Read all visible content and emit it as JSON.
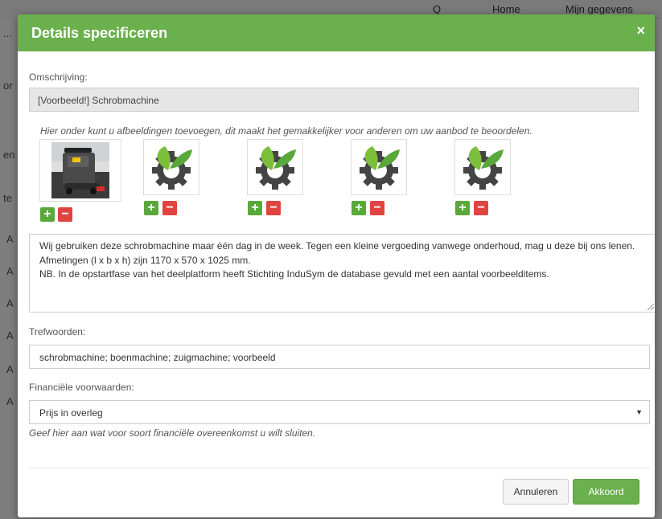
{
  "background": {
    "nav": {
      "search": "Q",
      "home": "Home",
      "account": "Mijn gegevens"
    },
    "left_fragments": [
      "...",
      "or",
      "en",
      "te",
      "A",
      "A",
      "A",
      "A",
      "A",
      "A"
    ]
  },
  "modal": {
    "title": "Details specificeren",
    "close": "×",
    "description_label": "Omschrijving:",
    "description_value": "[Voorbeeld!] Schrobmachine",
    "images_hint": "Hier onder kunt u afbeeldingen toevoegen, dit maakt het gemakkelijker voor anderen om uw aanbod te beoordelen.",
    "image_buttons": {
      "add": "+",
      "remove": "−"
    },
    "images": [
      {
        "kind": "photo",
        "icon": "scrubber-machine-photo"
      },
      {
        "kind": "placeholder",
        "icon": "leaf-gear-icon"
      },
      {
        "kind": "placeholder",
        "icon": "leaf-gear-icon"
      },
      {
        "kind": "placeholder",
        "icon": "leaf-gear-icon"
      },
      {
        "kind": "placeholder",
        "icon": "leaf-gear-icon"
      }
    ],
    "long_description": [
      "Wij gebruiken deze schrobmachine maar één dag in de week.  Tegen een kleine vergoeding vanwege onderhoud, mag u deze bij ons lenen.",
      "Afmetingen (l x b x h) zijn 1170 x 570 x 1025 mm.",
      "NB. In de opstartfase van het deelplatform heeft Stichting InduSym de database gevuld met een aantal voorbeelditems."
    ],
    "keywords_label": "Trefwoorden:",
    "keywords_value": "schrobmachine; boenmachine; zuigmachine; voorbeeld",
    "financial_label": "Financiële voorwaarden:",
    "financial_selected": "Prijs in overleg",
    "financial_hint": "Geef hier aan wat voor soort financiële overeenkomst u wilt sluiten.",
    "cancel_label": "Annuleren",
    "ok_label": "Akkoord"
  },
  "colors": {
    "header": "#6ab04c",
    "plus": "#5aa83c",
    "minus": "#e0443e",
    "gear": "#444444",
    "leaf": "#7cbf3a"
  }
}
